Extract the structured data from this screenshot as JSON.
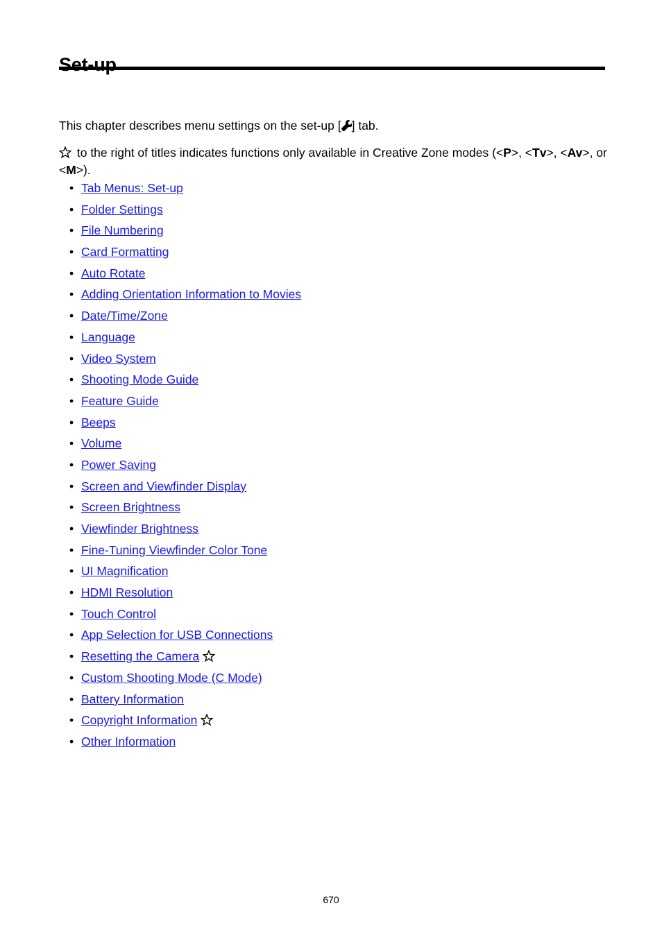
{
  "document": {
    "title": "Set-up",
    "page_number": "670"
  },
  "intro": {
    "line1_before_icon": "This chapter describes menu settings on the set-up [",
    "setup_tab_icon": "wrench-icon",
    "line1_after_icon": "] tab.",
    "line2_star_icon": "star-outline-icon",
    "line2_part1": " to the right of titles indicates functions only available in Creative Zone modes (<",
    "mode_p": "P",
    "line2_part2": ">, <",
    "mode_tv": "Tv",
    "line2_part3": ">, <",
    "mode_av": "Av",
    "line2_part4": ">, or <",
    "mode_m": "M",
    "line2_part5": ">)."
  },
  "toc": {
    "bullet": "•",
    "items": [
      {
        "label": "Tab Menus: Set-up",
        "star": false
      },
      {
        "label": "Folder Settings",
        "star": false
      },
      {
        "label": "File Numbering",
        "star": false
      },
      {
        "label": "Card Formatting",
        "star": false
      },
      {
        "label": "Auto Rotate",
        "star": false
      },
      {
        "label": "Adding Orientation Information to Movies",
        "star": false
      },
      {
        "label": "Date/Time/Zone",
        "star": false
      },
      {
        "label": "Language",
        "star": false
      },
      {
        "label": "Video System",
        "star": false
      },
      {
        "label": "Shooting Mode Guide",
        "star": false
      },
      {
        "label": "Feature Guide",
        "star": false
      },
      {
        "label": "Beeps",
        "star": false
      },
      {
        "label": "Volume",
        "star": false
      },
      {
        "label": "Power Saving",
        "star": false
      },
      {
        "label": "Screen and Viewfinder Display",
        "star": false
      },
      {
        "label": "Screen Brightness",
        "star": false
      },
      {
        "label": "Viewfinder Brightness",
        "star": false
      },
      {
        "label": "Fine-Tuning Viewfinder Color Tone",
        "star": false
      },
      {
        "label": "UI Magnification",
        "star": false
      },
      {
        "label": "HDMI Resolution",
        "star": false
      },
      {
        "label": "Touch Control",
        "star": false
      },
      {
        "label": "App Selection for USB Connections",
        "star": false
      },
      {
        "label": "Resetting the Camera",
        "star": true
      },
      {
        "label": "Custom Shooting Mode (C Mode)",
        "star": false
      },
      {
        "label": "Battery Information",
        "star": false
      },
      {
        "label": "Copyright Information",
        "star": true
      },
      {
        "label": "Other Information",
        "star": false
      }
    ]
  },
  "colors": {
    "link": "#1a18e0",
    "text": "#000000",
    "background": "#ffffff"
  }
}
